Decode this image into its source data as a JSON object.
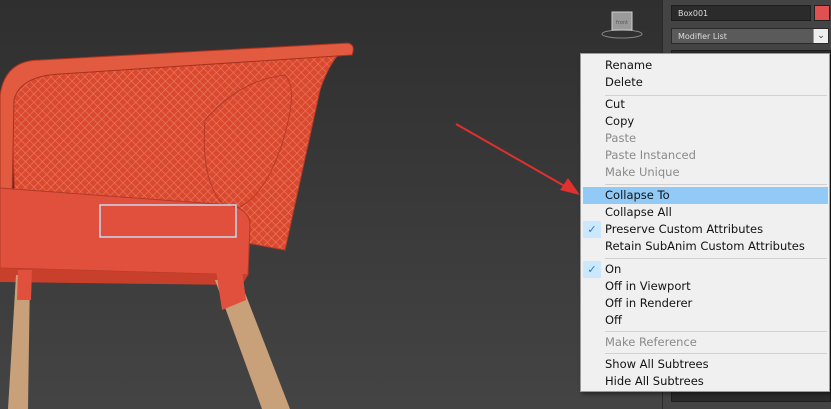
{
  "panel": {
    "object_name": "Box001",
    "object_color": "#e05050",
    "modifier_list": "Modifier List",
    "dropdown_icon": "chevron-down-icon"
  },
  "viewport": {
    "viewcube_label": "front"
  },
  "menu": {
    "rename": "Rename",
    "delete": "Delete",
    "cut": "Cut",
    "copy": "Copy",
    "paste": "Paste",
    "paste_instanced": "Paste Instanced",
    "make_unique": "Make Unique",
    "collapse_to": "Collapse To",
    "collapse_all": "Collapse All",
    "preserve_custom_attributes": "Preserve Custom Attributes",
    "retain_subanim": "Retain SubAnim Custom Attributes",
    "on": "On",
    "off_viewport": "Off in Viewport",
    "off_renderer": "Off in Renderer",
    "off": "Off",
    "make_reference": "Make Reference",
    "show_all_subtrees": "Show All Subtrees",
    "hide_all_subtrees": "Hide All Subtrees"
  },
  "colors": {
    "highlight": "#91c9f7",
    "arrow": "#e03030",
    "chair": "#e0503c"
  }
}
